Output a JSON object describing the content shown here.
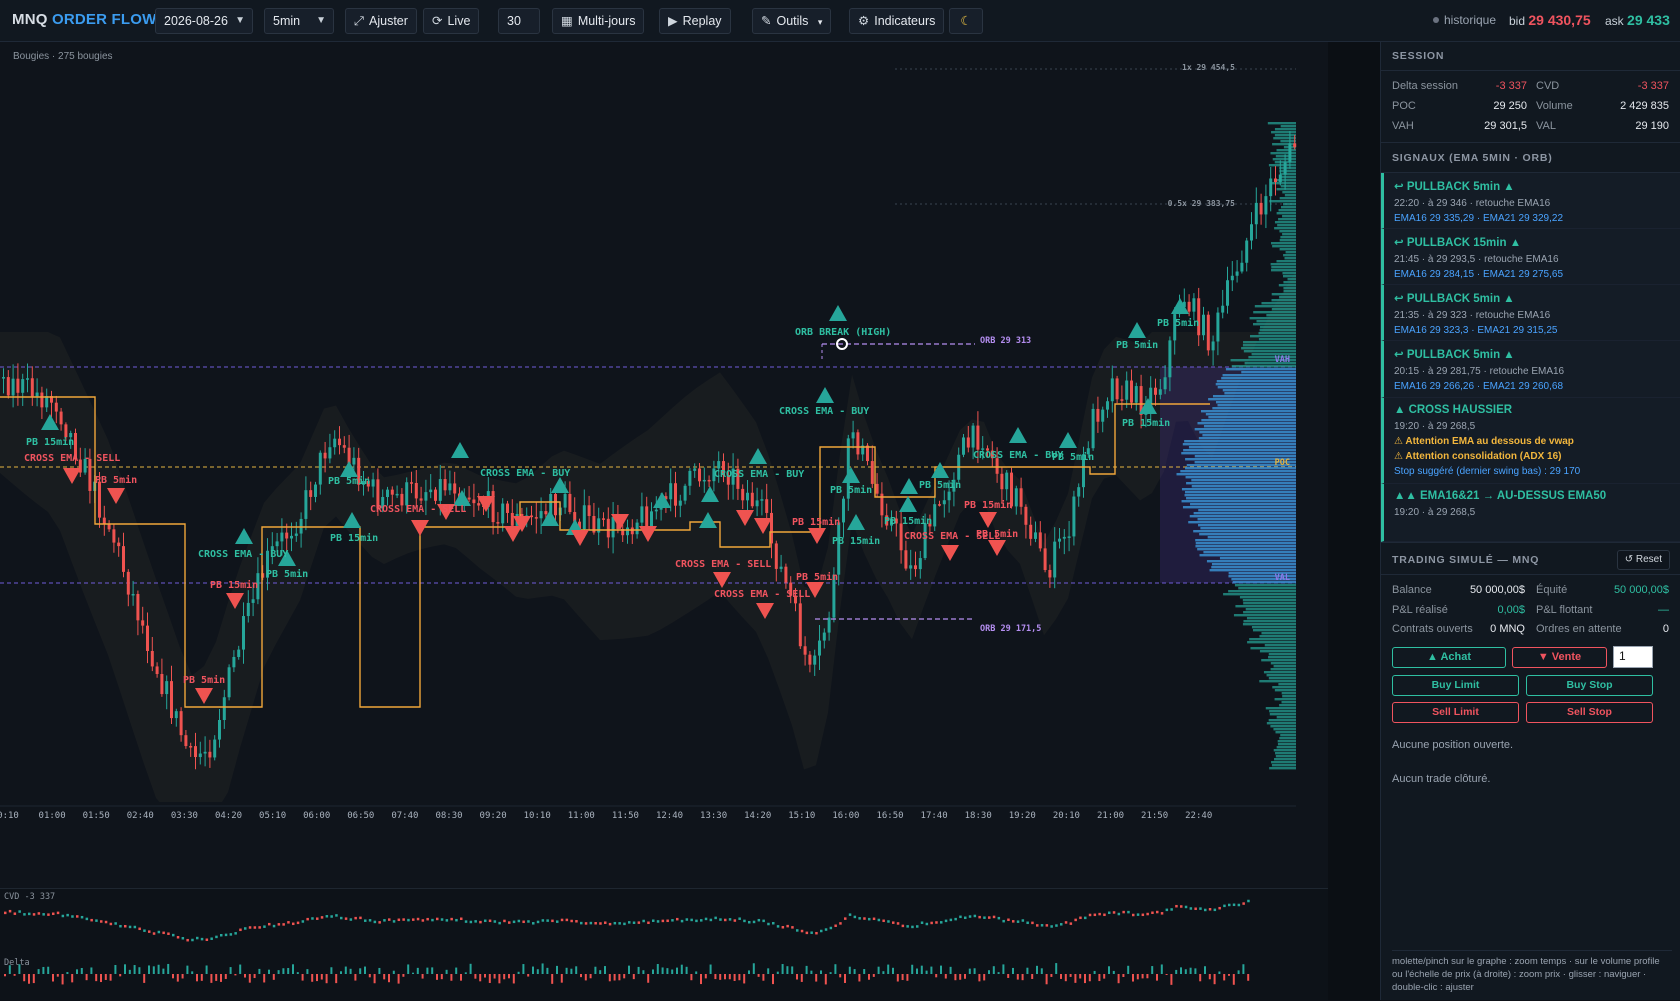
{
  "app": {
    "brand_part1": "MNQ",
    "brand_part2": "ORDER FLOW"
  },
  "toolbar": {
    "date": "2026-08-26",
    "interval": "5min",
    "fit_label": "Ajuster",
    "live_label": "Live",
    "count_value": "30",
    "multiday_label": "Multi-jours",
    "replay_label": "Replay",
    "tools_label": "Outils",
    "indicators_label": "Indicateurs"
  },
  "status": {
    "mode": "historique",
    "bid_label": "bid",
    "bid_value": "29 430,75",
    "ask_label": "ask",
    "ask_value": "29 433"
  },
  "colors": {
    "background": "#0f141b",
    "bull": "#26a69a",
    "bear": "#ef5350",
    "ema": "#f0a63a",
    "vwap_band": "#1a1d20",
    "value_area": "#6a45d6",
    "profile": "#3a8fd0",
    "poc": "#e3b341",
    "orb": "#b48ef0"
  },
  "chart": {
    "candle_count_label": "Bougies · 275 bougies",
    "price_tags": {
      "top": "1x 29 454,5",
      "mid": "0.5x 29 383,75"
    },
    "orb_high_label": "ORB 29 313",
    "orb_low_label": "ORB 29 171,5",
    "level_labels": {
      "vah": "VAH",
      "poc": "POC",
      "val": "VAL"
    },
    "time_labels": [
      "0:10",
      "01:00",
      "01:50",
      "02:40",
      "03:30",
      "04:20",
      "05:10",
      "06:00",
      "06:50",
      "07:40",
      "08:30",
      "09:20",
      "10:10",
      "11:00",
      "11:50",
      "12:40",
      "13:30",
      "14:20",
      "15:10",
      "16:00",
      "16:50",
      "17:40",
      "18:30",
      "19:20",
      "20:10",
      "21:00",
      "21:50",
      "22:40"
    ],
    "annotations": [
      {
        "text": "PB 15min",
        "color": "teal"
      },
      {
        "text": "CROSS EMA - SELL",
        "color": "red"
      },
      {
        "text": "PB 5min",
        "color": "red"
      },
      {
        "text": "CROSS EMA - BUY",
        "color": "teal"
      },
      {
        "text": "PB 5min",
        "color": "teal"
      },
      {
        "text": "PB 15min",
        "color": "red"
      },
      {
        "text": "PB 5min",
        "color": "red"
      },
      {
        "text": "PB 5min",
        "color": "teal"
      },
      {
        "text": "PB 15min",
        "color": "teal"
      },
      {
        "text": "CROSS EMA - SELL",
        "color": "red"
      },
      {
        "text": "CROSS EMA - BUY",
        "color": "teal"
      },
      {
        "text": "CROSS EMA - BUY",
        "color": "teal"
      },
      {
        "text": "CROSS EMA - SELL",
        "color": "red"
      },
      {
        "text": "CROSS EMA - SELL",
        "color": "red"
      },
      {
        "text": "PB 15min",
        "color": "red"
      },
      {
        "text": "PB 5min",
        "color": "red"
      },
      {
        "text": "ORB BREAK (HIGH)",
        "color": "teal"
      },
      {
        "text": "CROSS EMA - BUY",
        "color": "teal"
      },
      {
        "text": "PB 5min",
        "color": "teal"
      },
      {
        "text": "PB 15min",
        "color": "teal"
      },
      {
        "text": "PB 15min",
        "color": "teal"
      },
      {
        "text": "PB 5min",
        "color": "teal"
      },
      {
        "text": "CROSS EMA - SELL",
        "color": "red"
      },
      {
        "text": "PB 15min",
        "color": "red"
      },
      {
        "text": "PB 5min",
        "color": "red"
      },
      {
        "text": "CROSS EMA - BUY",
        "color": "teal"
      },
      {
        "text": "PB 5min",
        "color": "teal"
      },
      {
        "text": "PB 15min",
        "color": "teal"
      },
      {
        "text": "PB 5min",
        "color": "teal"
      },
      {
        "text": "PB 5min",
        "color": "teal"
      }
    ],
    "cvd_label": "CVD -3 337",
    "delta_label": "Delta"
  },
  "session": {
    "title": "SESSION",
    "delta_label": "Delta session",
    "delta_value": "-3 337",
    "cvd_label": "CVD",
    "cvd_value": "-3 337",
    "poc_label": "POC",
    "poc_value": "29 250",
    "volume_label": "Volume",
    "volume_value": "2 429 835",
    "vah_label": "VAH",
    "vah_value": "29 301,5",
    "val_label": "VAL",
    "val_value": "29 190"
  },
  "signals": {
    "title": "SIGNAUX (EMA 5MIN · ORB)",
    "items": [
      {
        "title": "↩ PULLBACK 5min ▲",
        "sub": "22:20 · à 29 346 · retouche EMA16",
        "ema": "EMA16 29 335,29 · EMA21 29 329,22"
      },
      {
        "title": "↩ PULLBACK 15min ▲",
        "sub": "21:45 · à 29 293,5 · retouche EMA16",
        "ema": "EMA16 29 284,15 · EMA21 29 275,65"
      },
      {
        "title": "↩ PULLBACK 5min ▲",
        "sub": "21:35 · à 29 323 · retouche EMA16",
        "ema": "EMA16 29 323,3 · EMA21 29 315,25"
      },
      {
        "title": "↩ PULLBACK 5min ▲",
        "sub": "20:15 · à 29 281,75 · retouche EMA16",
        "ema": "EMA16 29 266,26 · EMA21 29 260,68"
      },
      {
        "title": "▲ CROSS HAUSSIER",
        "sub": "19:20 · à 29 268,5",
        "warn1": "⚠ Attention EMA au dessous de vwap",
        "warn2": "⚠ Attention consolidation (ADX 16)",
        "stop": "Stop suggéré (dernier swing bas) : 29 170"
      },
      {
        "title": "▲▲ EMA16&21 → AU-DESSUS EMA50",
        "sub": "19:20 · à 29 268,5"
      }
    ]
  },
  "trading": {
    "title": "TRADING SIMULÉ — MNQ",
    "reset_label": "↺ Reset",
    "balance_label": "Balance",
    "balance_value": "50 000,00$",
    "equity_label": "Équité",
    "equity_value": "50 000,00$",
    "pnl_realized_label": "P&L réalisé",
    "pnl_realized_value": "0,00$",
    "pnl_floating_label": "P&L flottant",
    "pnl_floating_value": "—",
    "open_contracts_label": "Contrats ouverts",
    "open_contracts_value": "0 MNQ",
    "pending_orders_label": "Ordres en attente",
    "pending_orders_value": "0",
    "buy_label": "▲ Achat",
    "sell_label": "▼ Vente",
    "quantity": "1",
    "buy_limit_label": "Buy Limit",
    "buy_stop_label": "Buy Stop",
    "sell_limit_label": "Sell Limit",
    "sell_stop_label": "Sell Stop",
    "no_position": "Aucune position ouverte.",
    "no_trade": "Aucun trade clôturé."
  },
  "help": {
    "text": "molette/pinch sur le graphe : zoom temps · sur le volume profile ou l'échelle de prix (à droite) : zoom prix · glisser : naviguer · double-clic : ajuster"
  }
}
